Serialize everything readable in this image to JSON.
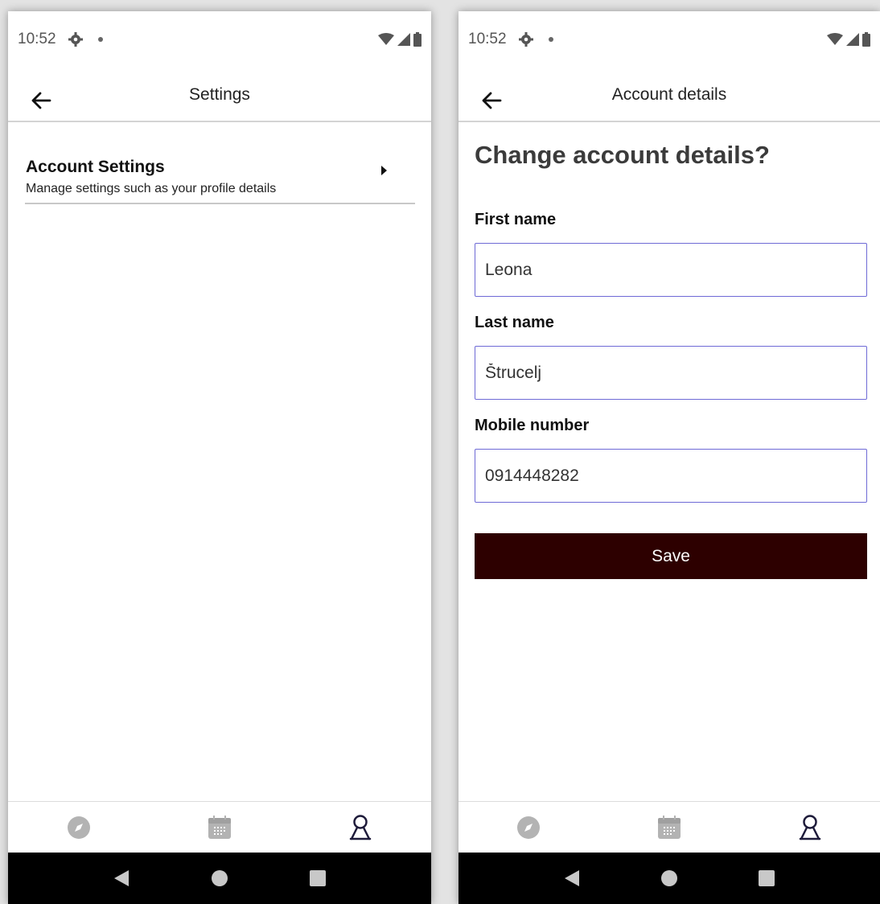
{
  "screens": [
    {
      "status": {
        "time": "10:52"
      },
      "app_bar": {
        "title": "Settings"
      },
      "settings_items": [
        {
          "title": "Account Settings",
          "subtitle": "Manage settings such as your profile details"
        }
      ],
      "nav": {
        "items": [
          "compass-icon",
          "calendar-icon",
          "profile-icon"
        ],
        "active": "profile-icon"
      }
    },
    {
      "status": {
        "time": "10:52"
      },
      "app_bar": {
        "title": "Account details"
      },
      "form": {
        "heading": "Change account details?",
        "fields": [
          {
            "label": "First name",
            "value": "Leona"
          },
          {
            "label": "Last name",
            "value": "Štrucelj"
          },
          {
            "label": "Mobile number",
            "value": "0914448282"
          }
        ],
        "save_label": "Save"
      },
      "nav": {
        "items": [
          "compass-icon",
          "calendar-icon",
          "profile-icon"
        ],
        "active": "profile-icon"
      }
    }
  ],
  "colors": {
    "input_border": "#6e6ad6",
    "save_button": "#2d0000",
    "inactive_icon": "#b3b3b3",
    "active_icon": "#1e1b3a"
  }
}
